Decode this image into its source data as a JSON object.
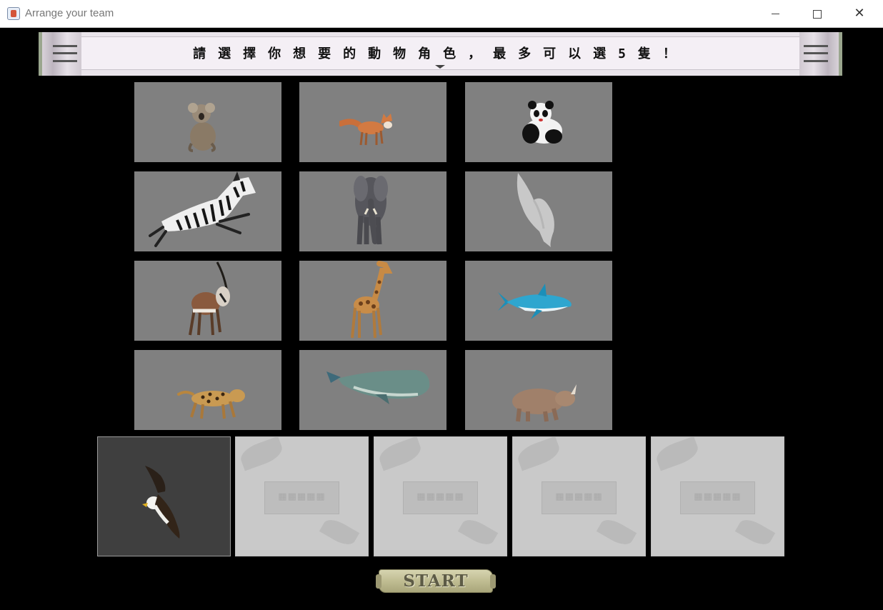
{
  "window": {
    "title": "Arrange your team",
    "app_icon": "java-icon",
    "controls": {
      "minimize": "minimize-icon",
      "maximize": "maximize-icon",
      "close": "close-icon"
    }
  },
  "banner": {
    "text": "請選擇你想要的動物角色，最多可以選5隻！"
  },
  "animals": [
    {
      "name": "koala",
      "icon": "koala-icon"
    },
    {
      "name": "fox",
      "icon": "fox-icon"
    },
    {
      "name": "panda",
      "icon": "panda-icon"
    },
    {
      "name": "zebra",
      "icon": "zebra-icon"
    },
    {
      "name": "elephant",
      "icon": "elephant-icon"
    },
    {
      "name": "seagull",
      "icon": "seagull-icon"
    },
    {
      "name": "oryx",
      "icon": "oryx-icon"
    },
    {
      "name": "giraffe",
      "icon": "giraffe-icon"
    },
    {
      "name": "shark",
      "icon": "shark-icon"
    },
    {
      "name": "jaguar",
      "icon": "jaguar-icon"
    },
    {
      "name": "sperm-whale",
      "icon": "whale-icon"
    },
    {
      "name": "rhino",
      "icon": "rhino-icon"
    }
  ],
  "team_slots": [
    {
      "state": "filled",
      "animal": "bald-eagle",
      "icon": "eagle-icon"
    },
    {
      "state": "empty"
    },
    {
      "state": "empty"
    },
    {
      "state": "empty"
    },
    {
      "state": "empty"
    }
  ],
  "start_button": {
    "label": "START"
  },
  "colors": {
    "background": "#000000",
    "tile": "#808080",
    "selected_slot": "#3f3f3f",
    "empty_slot": "#c9c9c9"
  }
}
